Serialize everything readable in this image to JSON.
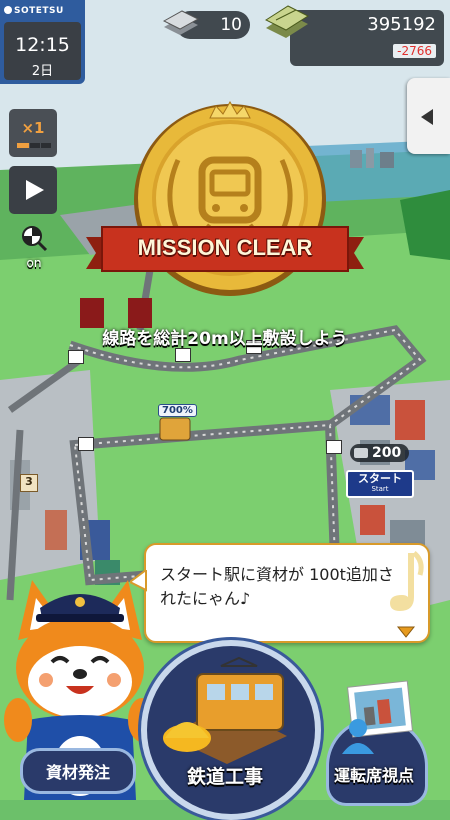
{
  "hud": {
    "brand": "SOTETSU",
    "time": "12:15",
    "day": "2日",
    "rails_count": "10",
    "money": "395192",
    "money_delta": "-2766",
    "speed": "×1",
    "toggle_label": "on"
  },
  "mission": {
    "banner": "MISSION CLEAR",
    "objective": "線路を総計20m以上敷設しよう"
  },
  "map": {
    "train_badge": "700%",
    "station_cargo": "200",
    "station_sign": "スタート",
    "station_sign_sub": "Start",
    "crate_number": "3"
  },
  "dialog": {
    "message": "スタート駅に資材が 100t追加されたにゃん♪"
  },
  "bottom_nav": {
    "left_label": "資材発注",
    "center_label": "鉄道工事",
    "right_label": "運転席視点"
  },
  "colors": {
    "grass": "#6cc06a",
    "gold": "#e6b53a",
    "ribbon_red": "#c8321e",
    "delta_red": "#e0302e",
    "panel": "#2e343a"
  }
}
